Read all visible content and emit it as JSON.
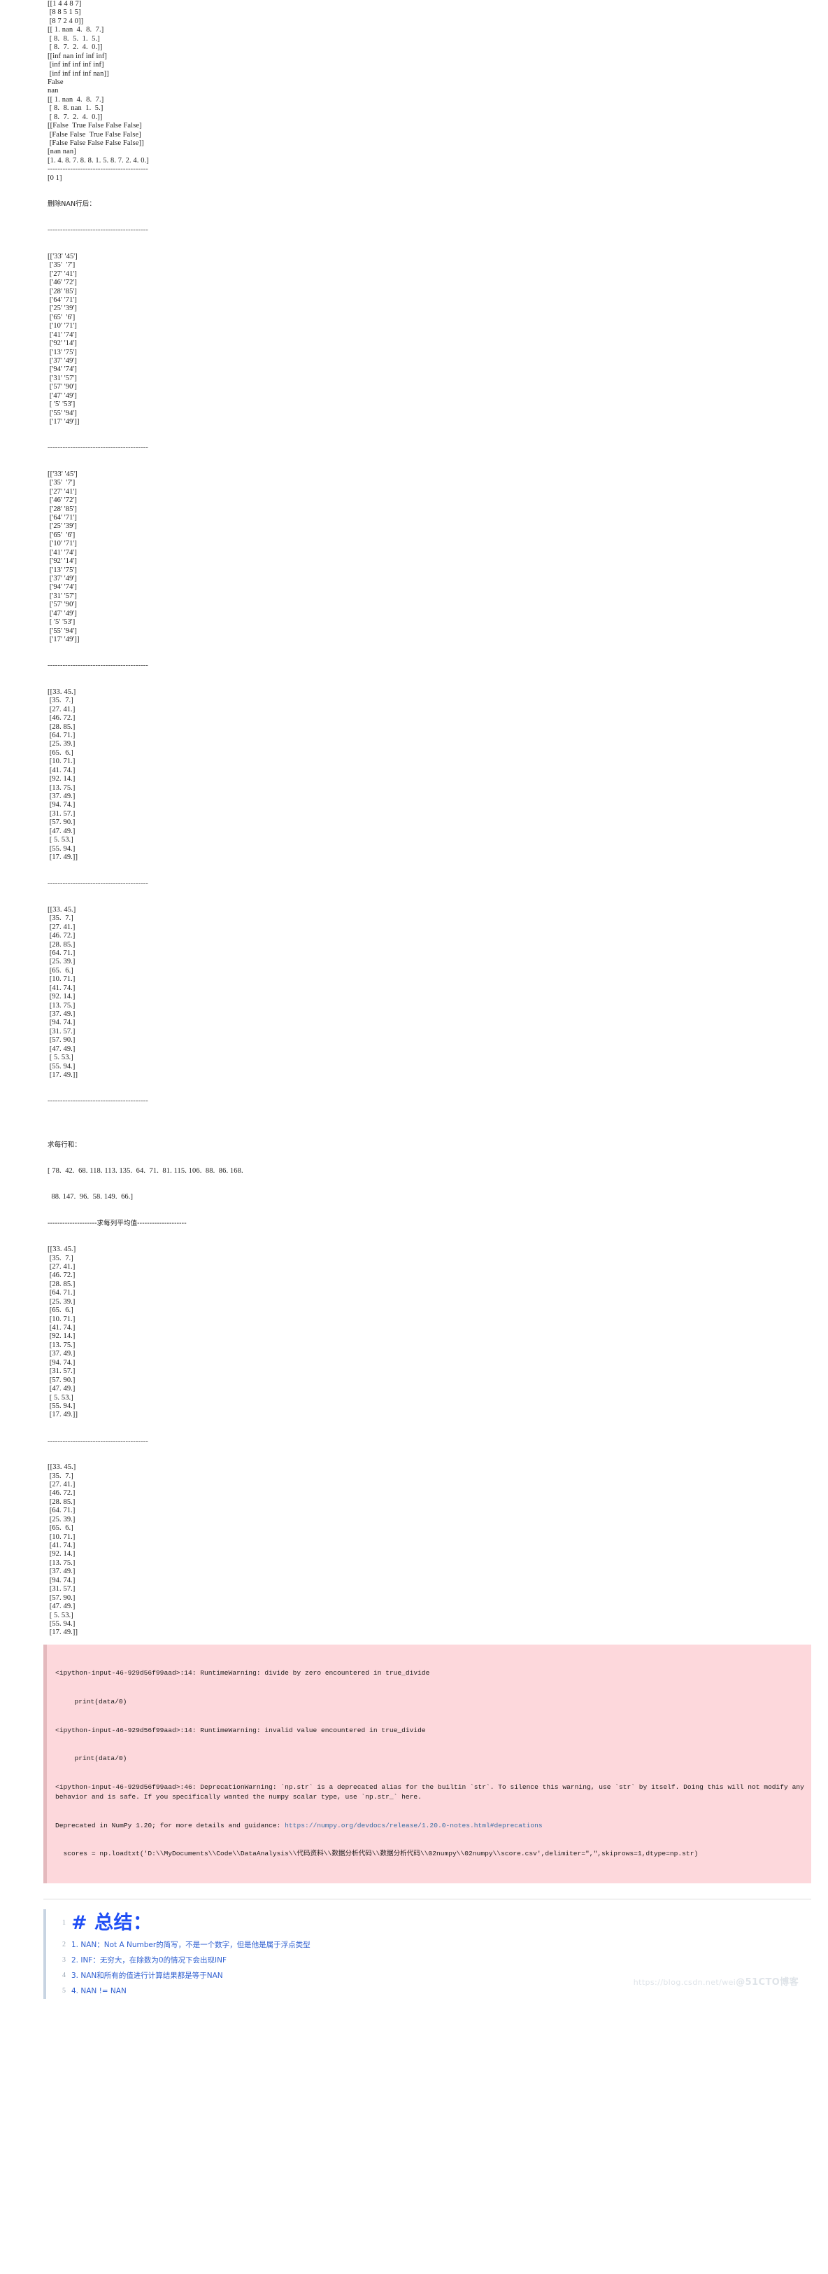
{
  "output_blocks": [
    {
      "name": "int-array-output",
      "lines": [
        "[[1 4 4 8 7]",
        " [8 8 5 1 5]",
        " [8 7 2 4 0]]",
        "[[ 1. nan  4.  8.  7.]",
        " [ 8.  8.  5.  1.  5.]",
        " [ 8.  7.  2.  4.  0.]]",
        "[[inf nan inf inf inf]",
        " [inf inf inf inf inf]",
        " [inf inf inf inf nan]]",
        "False",
        "nan",
        "[[ 1. nan  4.  8.  7.]",
        " [ 8.  8. nan  1.  5.]",
        " [ 8.  7.  2.  4.  0.]]",
        "[[False  True False False False]",
        " [False False  True False False]",
        " [False False False False False]]",
        "[nan nan]",
        "[1. 4. 8. 7. 8. 8. 1. 5. 8. 7. 2. 4. 0.]",
        "----------------------------------------",
        "[0 1]"
      ]
    }
  ],
  "labels": {
    "drop_nan_rows": "删除NAN行后：",
    "row_sum": "求每行和：",
    "col_mean_sep": "--------------------求每列平均值--------------------"
  },
  "separator": "----------------------------------------",
  "string_array": {
    "name": "string-array-output",
    "rows": [
      [
        "33",
        "45"
      ],
      [
        "35",
        "7"
      ],
      [
        "27",
        "41"
      ],
      [
        "46",
        "72"
      ],
      [
        "28",
        "85"
      ],
      [
        "64",
        "71"
      ],
      [
        "25",
        "39"
      ],
      [
        "65",
        "6"
      ],
      [
        "10",
        "71"
      ],
      [
        "41",
        "74"
      ],
      [
        "92",
        "14"
      ],
      [
        "13",
        "75"
      ],
      [
        "37",
        "49"
      ],
      [
        "94",
        "74"
      ],
      [
        "31",
        "57"
      ],
      [
        "57",
        "90"
      ],
      [
        "47",
        "49"
      ],
      [
        "5",
        "53"
      ],
      [
        "55",
        "94"
      ],
      [
        "17",
        "49"
      ]
    ]
  },
  "float_array": {
    "name": "float-array-output",
    "rows": [
      [
        "33.",
        "45."
      ],
      [
        "35.",
        "7."
      ],
      [
        "27.",
        "41."
      ],
      [
        "46.",
        "72."
      ],
      [
        "28.",
        "85."
      ],
      [
        "64.",
        "71."
      ],
      [
        "25.",
        "39."
      ],
      [
        "65.",
        "6."
      ],
      [
        "10.",
        "71."
      ],
      [
        "41.",
        "74."
      ],
      [
        "92.",
        "14."
      ],
      [
        "13.",
        "75."
      ],
      [
        "37.",
        "49."
      ],
      [
        "94.",
        "74."
      ],
      [
        "31.",
        "57."
      ],
      [
        "57.",
        "90."
      ],
      [
        "47.",
        "49."
      ],
      [
        "5.",
        "53."
      ],
      [
        "55.",
        "94."
      ],
      [
        "17.",
        "49."
      ]
    ]
  },
  "row_sums": {
    "line1": "[ 78.  42.  68. 118. 113. 135.  64.  71.  81. 115. 106.  88.  86. 168.",
    "line2": "  88. 147.  96.  58. 149.  66.]"
  },
  "warnings": {
    "name": "runtime-warning-box",
    "lines": [
      "<ipython-input-46-929d56f99aad>:14: RuntimeWarning: divide by zero encountered in true_divide",
      "  print(data/0)",
      "<ipython-input-46-929d56f99aad>:14: RuntimeWarning: invalid value encountered in true_divide",
      "  print(data/0)"
    ],
    "deprecation_head": "<ipython-input-46-929d56f99aad>:46: DeprecationWarning: `np.str` is a deprecated alias for the builtin `str`. To silence this warning, use `str` by itself. Doing this will not modify any behavior and is safe. If you specifically wanted the numpy scalar type, use `np.str_` here.",
    "deprecation_tail_pre": "Deprecated in NumPy 1.20; for more details and guidance: ",
    "deprecation_link": "https://numpy.org/devdocs/release/1.20.0-notes.html#deprecations",
    "code_line": "  scores = np.loadtxt('D:\\\\MyDocuments\\\\Code\\\\DataAnalysis\\\\代码资料\\\\数据分析代码\\\\数据分析代码\\\\02numpy\\\\02numpy\\\\score.csv',delimiter=\",\",skiprows=1,dtype=np.str)"
  },
  "summary": {
    "name": "summary-markdown-cell",
    "heading": "# 总结：",
    "items": [
      "1. NAN：Not A Number的简写，不是一个数字，但是他是属于浮点类型",
      "2. INF：无穷大，在除数为0的情况下会出现INF",
      "3. NAN和所有的值进行计算结果都是等于NAN",
      "4. NAN != NAN"
    ],
    "gutter_numbers": [
      "1",
      "2",
      "3",
      "4",
      "5"
    ]
  },
  "watermark": {
    "url": "https://blog.csdn.net/wei",
    "brand": "@51CTO博客"
  },
  "colors": {
    "warning_bg": "#fdd8dc",
    "link": "#3a6ea5",
    "heading": "#1f4ef5",
    "list": "#2f5fd0",
    "text": "#202020"
  }
}
